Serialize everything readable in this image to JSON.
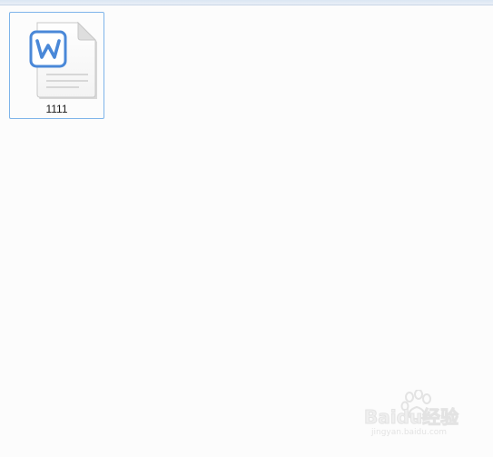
{
  "files": [
    {
      "name": "1111",
      "icon": "word-document-icon"
    }
  ],
  "watermark": {
    "brand": "Baidu经验",
    "url": "jingyan.baidu.com"
  },
  "colors": {
    "selection_border": "#7eb4ea",
    "word_blue": "#4a88d8",
    "background": "#fcfcfc"
  }
}
